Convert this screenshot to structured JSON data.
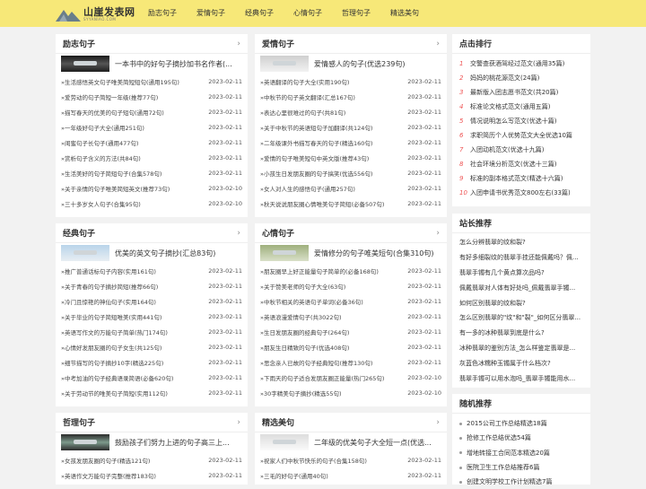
{
  "header": {
    "logo_title": "山崖发表网",
    "logo_sub": "SYYANIAO.COM",
    "nav": [
      "励志句子",
      "爱情句子",
      "经典句子",
      "心情句子",
      "哲理句子",
      "精选美句"
    ]
  },
  "panels": [
    {
      "title": "励志句子",
      "featured": "一本书中的好句子摘抄加书名作者(...",
      "items": [
        {
          "t": "»生活感悟英文句子唯美简短短句(通用195句)",
          "d": "2023-02-11"
        },
        {
          "t": "»爱劳动的句子简短一年级(推荐77句)",
          "d": "2023-02-11"
        },
        {
          "t": "»描写春天的优美的句子短句(通用72句)",
          "d": "2023-02-11"
        },
        {
          "t": "»一年级好句子大全(通用251句)",
          "d": "2023-02-11"
        },
        {
          "t": "»闺蜜句子长句子(通用477句)",
          "d": "2023-02-11"
        },
        {
          "t": "»赏析句子含义的方法(共84句)",
          "d": "2023-02-11"
        },
        {
          "t": "»生活美好的句子简短句子(合集578句)",
          "d": "2023-02-11"
        },
        {
          "t": "»关于亲情的句子唯美简短英文(推荐73句)",
          "d": "2023-02-10"
        },
        {
          "t": "»三十多岁女人句子(合集95句)",
          "d": "2023-02-10"
        }
      ]
    },
    {
      "title": "爱情句子",
      "featured": "爱情感人的句子(优选239句)",
      "items": [
        {
          "t": "»英语翻译的句子大全(实用190句)",
          "d": "2023-02-11"
        },
        {
          "t": "»中秋节的句子英文翻译(汇总167句)",
          "d": "2023-02-11"
        },
        {
          "t": "»表达心里很难过的句子(共81句)",
          "d": "2023-02-11"
        },
        {
          "t": "»关于中秋节的英语短句子加翻译(共124句)",
          "d": "2023-02-11"
        },
        {
          "t": "»二年级课外书描写春天的句子(精选160句)",
          "d": "2023-02-11"
        },
        {
          "t": "»爱情的句子唯美短句中英文版(推荐43句)",
          "d": "2023-02-11"
        },
        {
          "t": "»小孩生日发朋友圈的句子搞笑(优选556句)",
          "d": "2023-02-11"
        },
        {
          "t": "»女人对人生的感悟句子(通用257句)",
          "d": "2023-02-11"
        },
        {
          "t": "»秋天说说朋友圈心情唯美句子简短(必备507句)",
          "d": "2023-02-11"
        }
      ]
    },
    {
      "title": "经典句子",
      "featured": "优美的英文句子摘抄(汇总83句)",
      "items": [
        {
          "t": "»推广普通话标句子内容(实用161句)",
          "d": "2023-02-11"
        },
        {
          "t": "»关于青春的句子摘抄简短(推荐66句)",
          "d": "2023-02-11"
        },
        {
          "t": "»冷门且惊艳的神仙句子(实用164句)",
          "d": "2023-02-11"
        },
        {
          "t": "»关于毕业的句子简短唯美(实用441句)",
          "d": "2023-02-11"
        },
        {
          "t": "»英语写作文的万能句子简单(热门174句)",
          "d": "2023-02-11"
        },
        {
          "t": "»心情好发朋友圈的句子女生(共125句)",
          "d": "2023-02-11"
        },
        {
          "t": "»细节描写的句子摘抄10字(精选225句)",
          "d": "2023-02-11"
        },
        {
          "t": "»中考加油的句子经典语录简语(必备620句)",
          "d": "2023-02-11"
        },
        {
          "t": "»关于劳动节的唯美句子简短(实用112句)",
          "d": "2023-02-11"
        }
      ]
    },
    {
      "title": "心情句子",
      "featured": "爱情修分的句子唯美短句(合集310句)",
      "items": [
        {
          "t": "»朋友圈早上好正能量句子简单的(必备168句)",
          "d": "2023-02-11"
        },
        {
          "t": "»关于赞美老师的句子大全(63句)",
          "d": "2023-02-11"
        },
        {
          "t": "»中秋节相关的英语句子单词(必备36句)",
          "d": "2023-02-11"
        },
        {
          "t": "»英语浪漫爱情句子(共3022句)",
          "d": "2023-02-11"
        },
        {
          "t": "»生日发朋友圈的经典句子(264句)",
          "d": "2023-02-11"
        },
        {
          "t": "»朋友生日精致的句子(优选408句)",
          "d": "2023-02-11"
        },
        {
          "t": "»思念亲人已故的句子经典短句(推荐130句)",
          "d": "2023-02-11"
        },
        {
          "t": "»下雨天的句子适合发朋友圈正能量(热门265句)",
          "d": "2023-02-10"
        },
        {
          "t": "»30字精美句子摘抄(精选55句)",
          "d": "2023-02-10"
        }
      ]
    },
    {
      "title": "哲理句子",
      "featured": "鼓励孩子们努力上进的句子高三上...",
      "items": [
        {
          "t": "»女孩发朋友圈的句子(精选121句)",
          "d": "2023-02-11"
        },
        {
          "t": "»英语作文万能句子完整(推荐183句)",
          "d": "2023-02-11"
        }
      ]
    },
    {
      "title": "精选美句",
      "featured": "二年级的优美句子大全短一点(优选...",
      "items": [
        {
          "t": "»祝家人们中秋节快乐的句子(合集158句)",
          "d": "2023-02-11"
        },
        {
          "t": "»三毛的好句子(通用40句)",
          "d": "2023-02-11"
        }
      ]
    }
  ],
  "ranking": {
    "title": "点击排行",
    "items": [
      "交警查获酒驾经过范文(通用35篇)",
      "妈妈的桃花源范文(24篇)",
      "最新版入团志愿书范文(共20篇)",
      "标准论文格式范文(通用五篇)",
      "情况说明怎么写范文(优选十篇)",
      "求职简历个人优势范文大全优选10篇",
      "入团动机范文(优选十九篇)",
      "社会环境分析范文(优选十三篇)",
      "标准的副本格式范文(精选十六篇)",
      "入团申请书优秀范文800左右(33篇)"
    ]
  },
  "recommend": {
    "title": "站长推荐",
    "items": [
      "怎么分辨翡翠的纹和裂?",
      "有好多细裂纹的翡翠手挂还能佩戴吗？佩...",
      "翡翠手镯有几个黄点算次品吗?",
      "佩戴翡翠对人体有好处吗_佩戴翡翠手镯...",
      "如何区别翡翠的纹和裂?",
      "怎么区别翡翠的\"纹\"和\"裂\"_如何区分翡翠...",
      "有一多的冰种翡翠到底是什么?",
      "冰种翡翠的鉴别方法_怎么样鉴定翡翠是...",
      "灰蓝色冰糯种玉镯属于什么档次?",
      "翡翠手镯可以用水泡吗_翡翠手镯能用水..."
    ]
  },
  "random": {
    "title": "随机推荐",
    "items": [
      "2015公司工作总结精选18篇",
      "抢修工作总结优选54篇",
      "增地转接工合同范本精选20篇",
      "医院卫生工作总结推荐6篇",
      "创建文明学校工作计划精选7篇"
    ]
  }
}
